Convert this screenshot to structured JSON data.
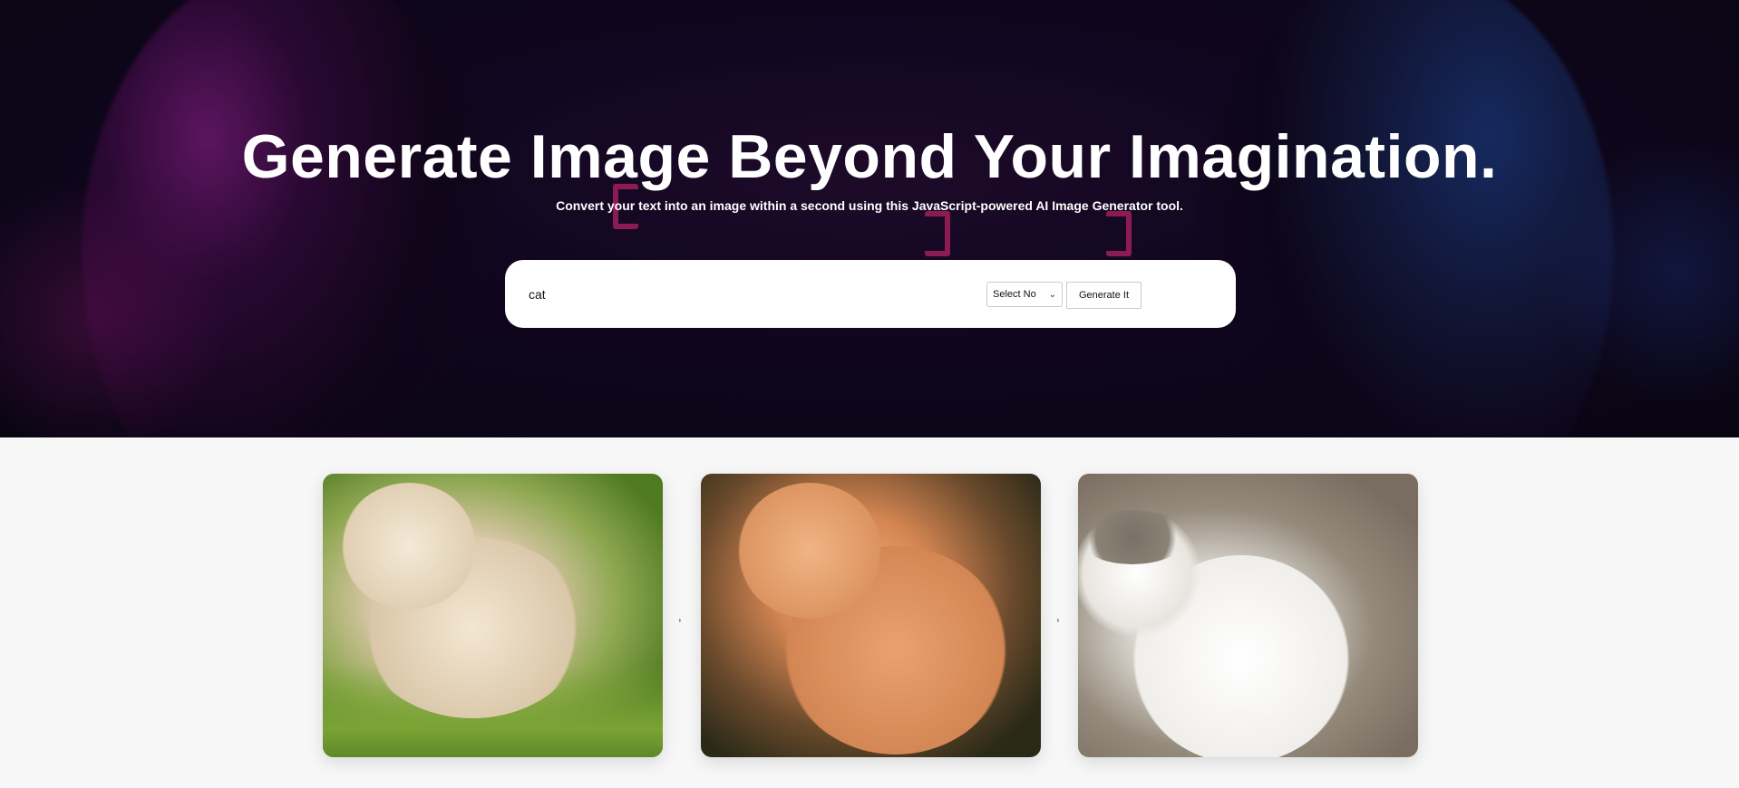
{
  "hero": {
    "title": "Generate Image Beyond Your Imagination.",
    "subtitle": "Convert your text into an image within a second using this JavaScript-powered AI Image Generator tool."
  },
  "form": {
    "prompt_value": "cat",
    "count_select_value": "Select No",
    "generate_label": "Generate It"
  },
  "gallery": {
    "images": [
      {
        "alt": "cat",
        "icon": "cat-photo-icon"
      },
      {
        "alt": "cat",
        "icon": "cat-photo-icon"
      },
      {
        "alt": "cat",
        "icon": "cat-photo-icon"
      }
    ],
    "separator": ","
  }
}
